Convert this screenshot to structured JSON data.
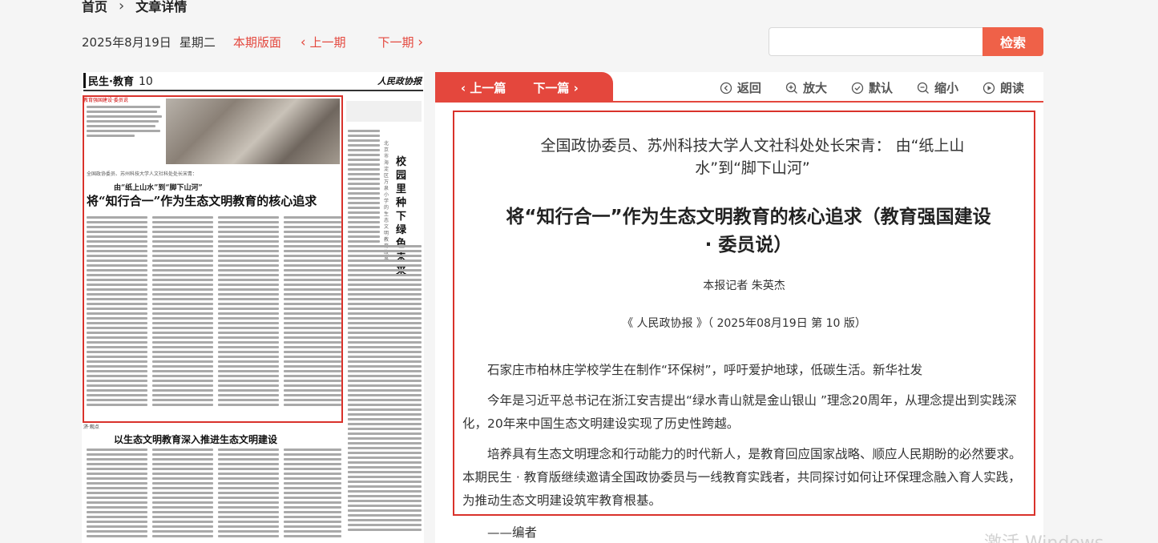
{
  "breadcrumb": {
    "home": "首页",
    "separator": "›",
    "current": "文章详情"
  },
  "toolbar": {
    "date": "2025年8月19日",
    "weekday": "星期二",
    "edition_link": "本期版面",
    "prev_issue": "上一期",
    "next_issue": "下一期"
  },
  "search": {
    "value": "",
    "button": "检索"
  },
  "newspaper": {
    "section": "民生·教育",
    "page_no": "10",
    "logo": "人民政协报",
    "subhead": "全国政协委员、苏州科技大学人文社科处处长宋青：",
    "deck": "由“纸上山水”到“脚下山河”",
    "headline": "将“知行合一”作为生态文明教育的核心追求",
    "sidebar_title": "校园里种下绿色未来",
    "sidebar_sub": "北京市海淀区万泉小学的生态文明教育故事",
    "bottom_headline": "以生态文明教育深入推进生态文明建设",
    "tag_top": "教育强国建设·委员说",
    "tag_bottom": "济·观点"
  },
  "article_nav": {
    "prev_article": "上一篇",
    "next_article": "下一篇",
    "tools": [
      {
        "label": "返回",
        "icon": "back-icon"
      },
      {
        "label": "放大",
        "icon": "zoom-in-icon"
      },
      {
        "label": "默认",
        "icon": "default-icon"
      },
      {
        "label": "缩小",
        "icon": "zoom-out-icon"
      },
      {
        "label": "朗读",
        "icon": "play-icon"
      }
    ]
  },
  "article": {
    "subtitle": "全国政协委员、苏州科技大学人文社科处处长宋青： 由“纸上山水”到“脚下山河”",
    "title": "将“知行合一”作为生态文明教育的核心追求（教育强国建设 · 委员说）",
    "byline": "本报记者 朱英杰",
    "source": "《 人民政协报 》（ 2025年08月19日 第 10 版）",
    "paragraphs": [
      "石家庄市柏林庄学校学生在制作“环保树”，呼吁爱护地球，低碳生活。新华社发",
      "今年是习近平总书记在浙江安吉提出“绿水青山就是金山银山 ”理念20周年，从理念提出到实践深化，20年来中国生态文明建设实现了历史性跨越。",
      "培养具有生态文明理念和行动能力的时代新人，是教育回应国家战略、顺应人民期盼的必然要求。本期民生 · 教育版继续邀请全国政协委员与一线教育实践者，共同探讨如何让环保理念融入育人实践，为推动生态文明建设筑牢教育根基。"
    ],
    "editor_note": "——编者"
  },
  "watermark": "激活 Windows",
  "colors": {
    "accent": "#e4473d",
    "search_button": "#ef6148",
    "highlight_border": "#d9322b"
  }
}
